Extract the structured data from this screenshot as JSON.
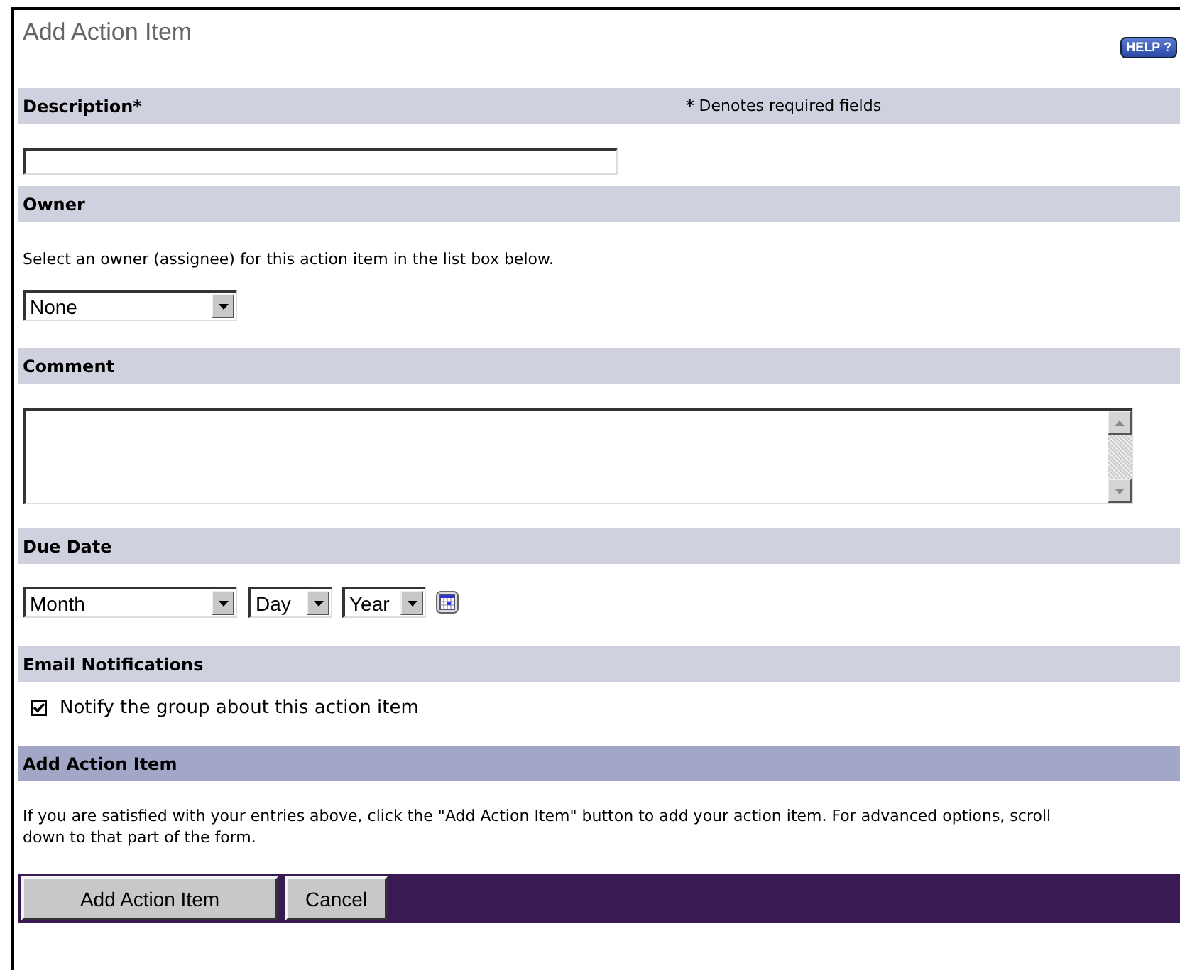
{
  "title": "Add Action Item",
  "help_button": "HELP ?",
  "sections": [
    {
      "kind": "text-field",
      "heading": "Description",
      "required_mark": "*",
      "note_mark": "*",
      "note": "Denotes required fields"
    },
    {
      "kind": "select",
      "heading": "Owner",
      "hint": "Select an owner (assignee) for this action item in the list box below.",
      "selects": [
        {
          "value": "None"
        }
      ]
    },
    {
      "kind": "textarea",
      "heading": "Comment"
    },
    {
      "kind": "date",
      "heading": "Due Date",
      "selects": [
        {
          "value": "Month"
        },
        {
          "value": "Day"
        },
        {
          "value": "Year"
        }
      ]
    },
    {
      "kind": "checkbox",
      "heading": "Email Notifications",
      "checkbox": {
        "label": "Notify the group about this action item",
        "checked": true
      }
    },
    {
      "kind": "submit",
      "heading": "Add Action Item",
      "text": "If you are satisfied with your entries above, click the \"Add Action Item\" button to add your action item. For advanced options, scroll down to that part of the form.",
      "buttons": [
        "Add Action Item",
        "Cancel"
      ]
    }
  ]
}
